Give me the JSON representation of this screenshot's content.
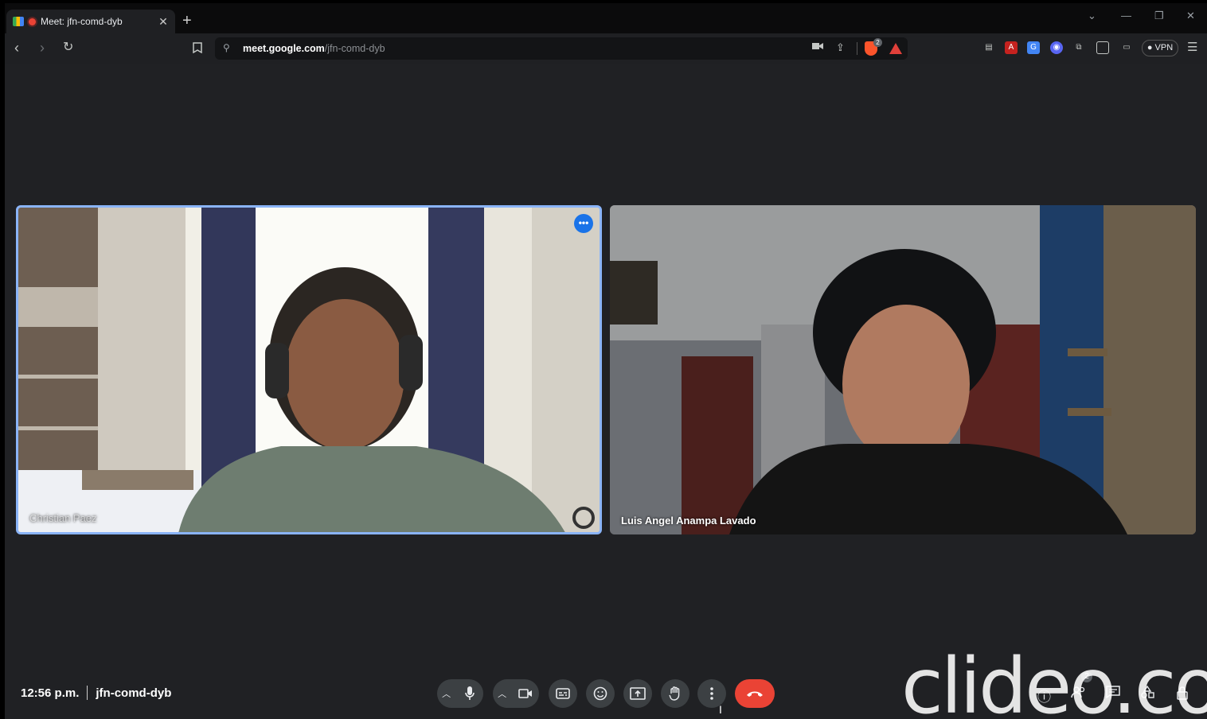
{
  "browser": {
    "tab_title": "Meet: jfn-comd-dyb",
    "new_tab_symbol": "+",
    "tab_close_symbol": "✕",
    "url_host": "meet.google.com",
    "url_path": "/jfn-comd-dyb",
    "shield_count": "2",
    "vpn_label": "VPN"
  },
  "meeting": {
    "time": "12:56 p.m.",
    "code": "jfn-comd-dyb",
    "participant_badge": "2"
  },
  "tiles": [
    {
      "name": "Christian Paez"
    },
    {
      "name": "Luis Angel Anampa Lavado"
    }
  ],
  "watermark": "clideo.com",
  "colors": {
    "background": "#202124",
    "active_speaker_border": "#8ab4f8",
    "end_call": "#ea4335",
    "control_bg": "#3c4043",
    "more_button": "#1a73e8"
  },
  "icons": {
    "controls": [
      "chevron-up",
      "mic",
      "chevron-up",
      "camera",
      "captions",
      "emoji",
      "present",
      "raise-hand",
      "more-vert",
      "end-call"
    ],
    "right": [
      "info",
      "people",
      "chat",
      "activities",
      "host-controls"
    ]
  }
}
